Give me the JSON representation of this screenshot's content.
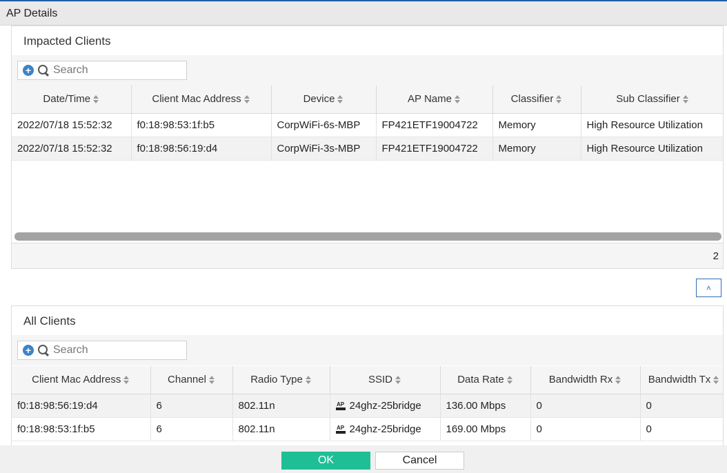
{
  "dialog": {
    "title": "AP Details",
    "ok_label": "OK",
    "cancel_label": "Cancel"
  },
  "impacted": {
    "title": "Impacted Clients",
    "search_placeholder": "Search",
    "columns": [
      "Date/Time",
      "Client Mac Address",
      "Device",
      "AP Name",
      "Classifier",
      "Sub Classifier"
    ],
    "rows": [
      [
        "2022/07/18 15:52:32",
        "f0:18:98:53:1f:b5",
        "CorpWiFi-6s-MBP",
        "FP421ETF19004722",
        "Memory",
        "High Resource Utilization"
      ],
      [
        "2022/07/18 15:52:32",
        "f0:18:98:56:19:d4",
        "CorpWiFi-3s-MBP",
        "FP421ETF19004722",
        "Memory",
        "High Resource Utilization"
      ]
    ],
    "count": "2"
  },
  "all": {
    "title": "All Clients",
    "search_placeholder": "Search",
    "columns": [
      "Client Mac Address",
      "Channel",
      "Radio Type",
      "SSID",
      "Data Rate",
      "Bandwidth Rx",
      "Bandwidth Tx"
    ],
    "rows": [
      [
        "f0:18:98:56:19:d4",
        "6",
        "802.11n",
        "24ghz-25bridge",
        "136.00 Mbps",
        "0",
        "0"
      ],
      [
        "f0:18:98:53:1f:b5",
        "6",
        "802.11n",
        "24ghz-25bridge",
        "169.00 Mbps",
        "0",
        "0"
      ]
    ],
    "ssid_icon_label": "AP"
  }
}
